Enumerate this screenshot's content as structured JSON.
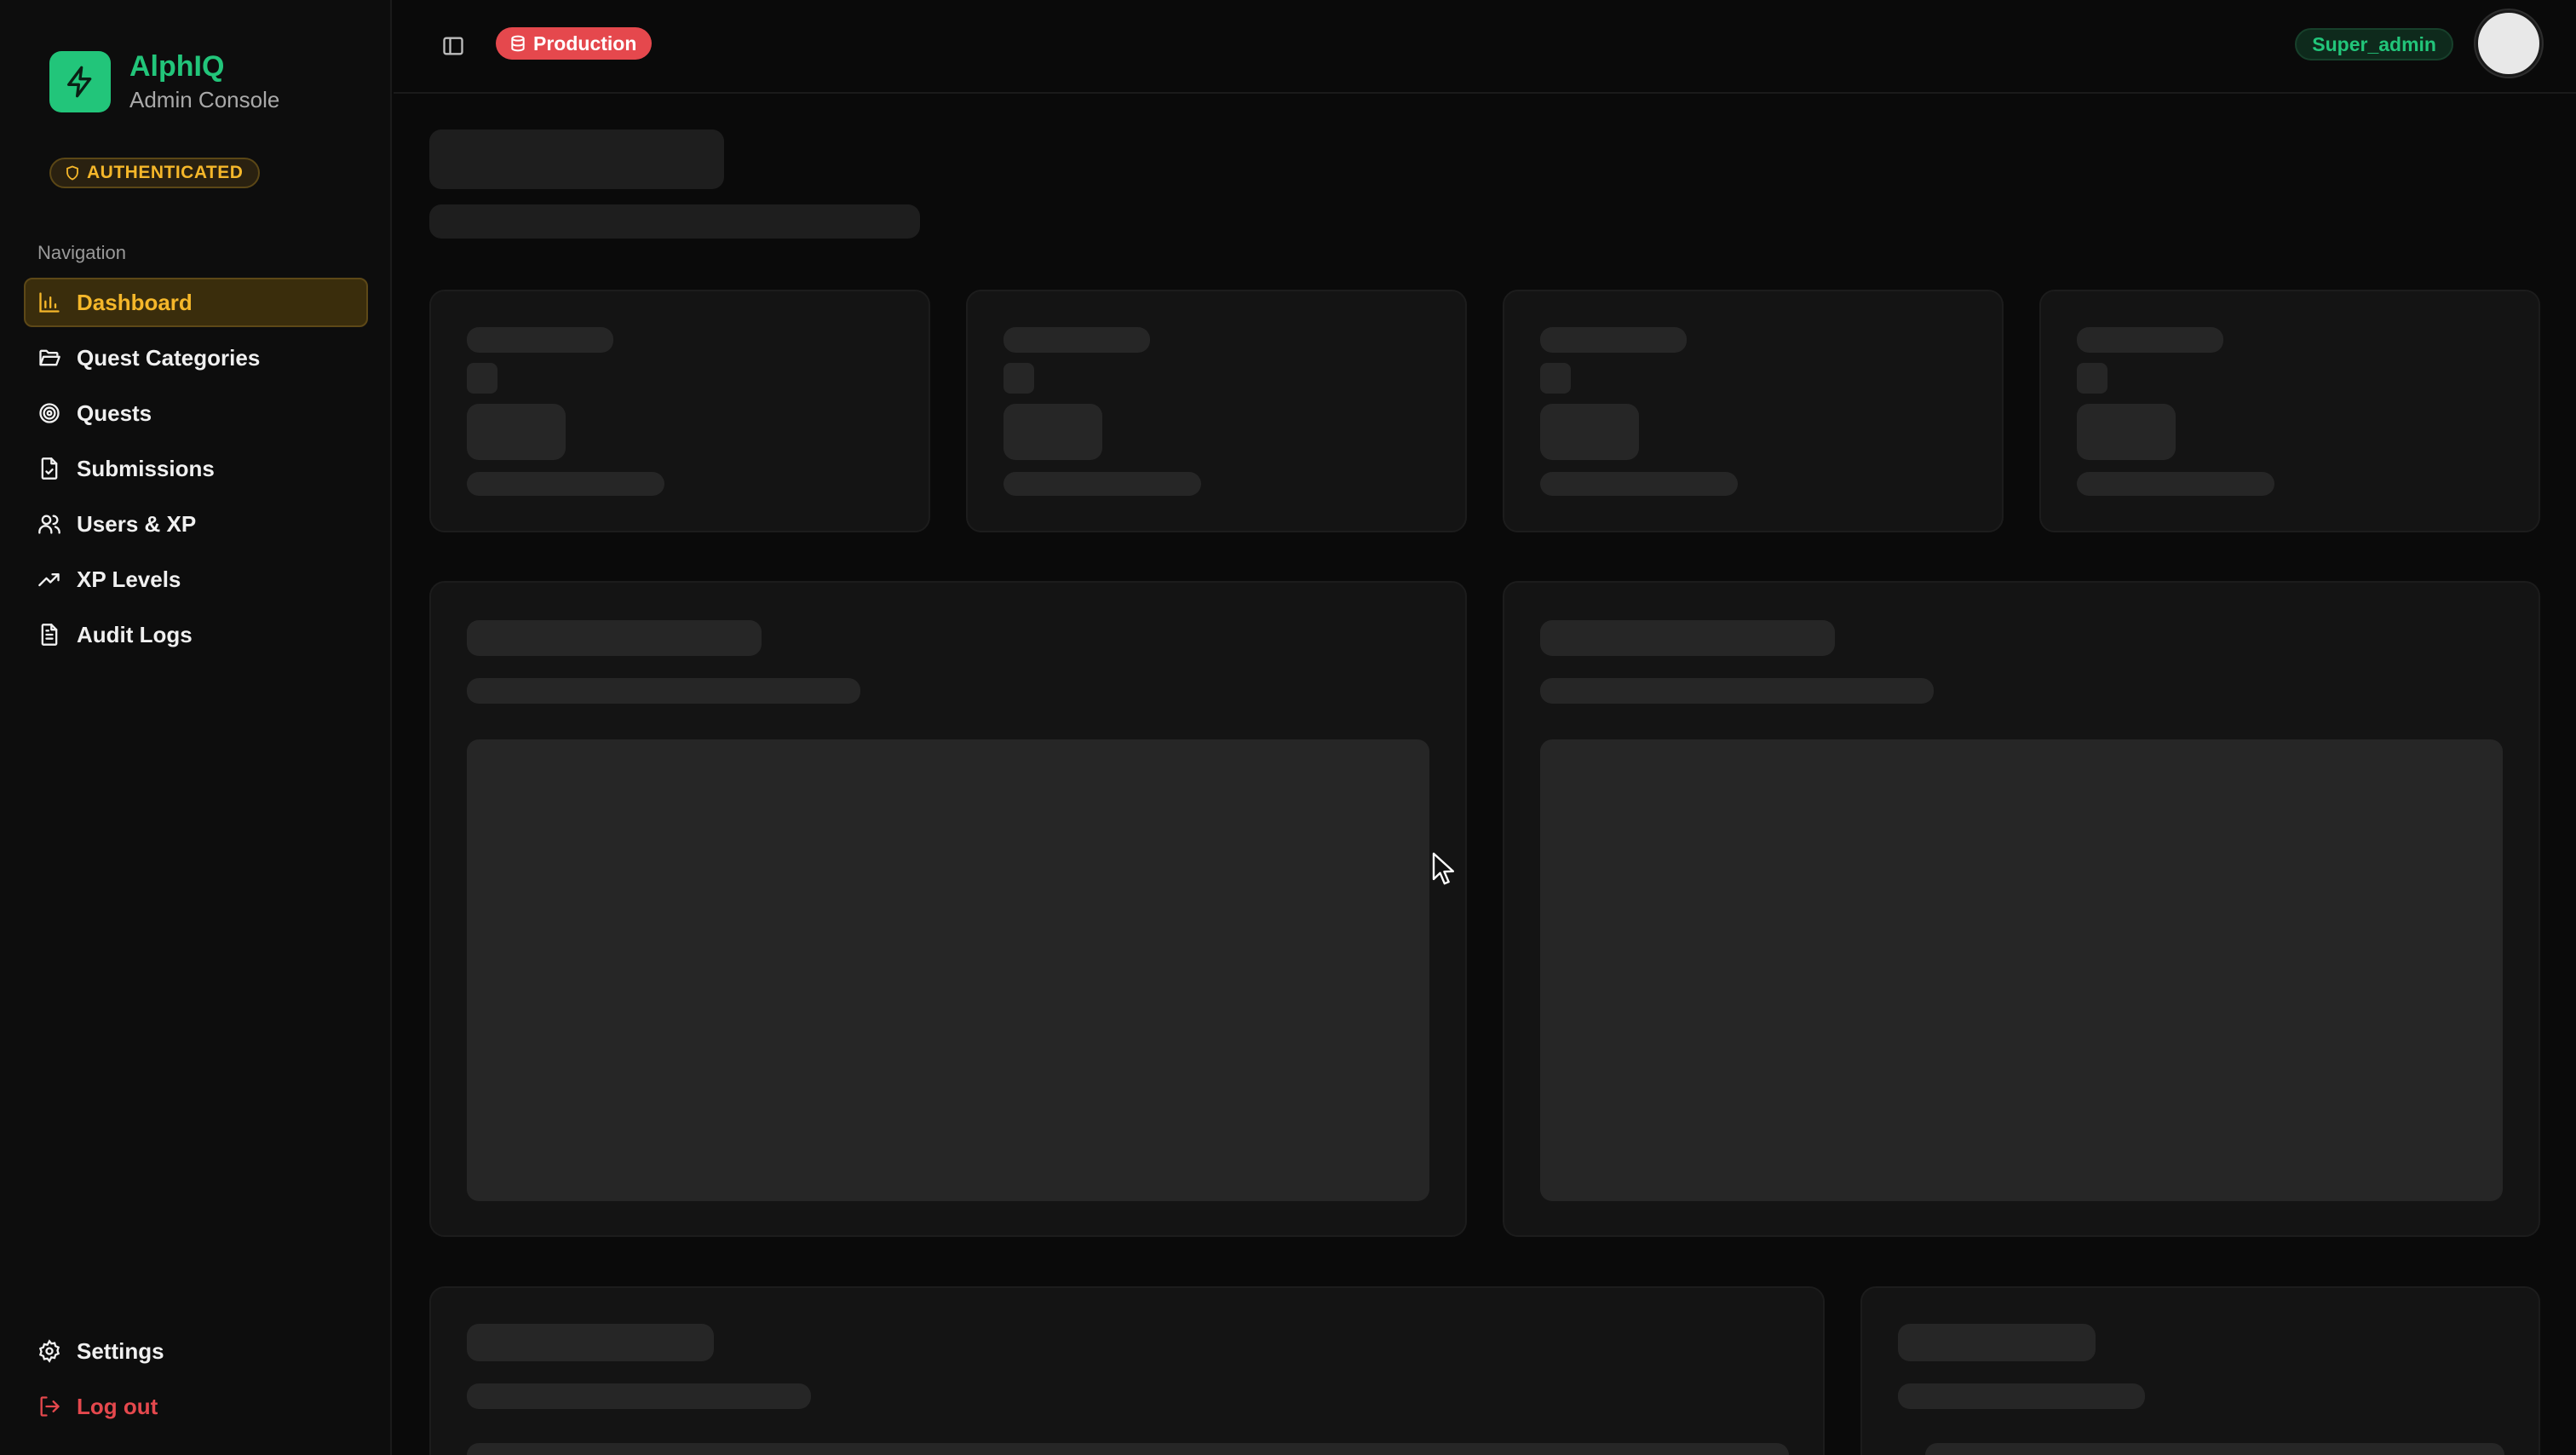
{
  "brand": {
    "name": "AlphIQ",
    "subtitle": "Admin Console",
    "accent": "#22c57a"
  },
  "auth_badge": {
    "label": "AUTHENTICATED",
    "color": "#f5b72a"
  },
  "sidebar": {
    "heading": "Navigation",
    "items": [
      {
        "label": "Dashboard",
        "icon": "bar-chart-icon",
        "active": true
      },
      {
        "label": "Quest Categories",
        "icon": "folder-open-icon",
        "active": false
      },
      {
        "label": "Quests",
        "icon": "target-icon",
        "active": false
      },
      {
        "label": "Submissions",
        "icon": "file-check-icon",
        "active": false
      },
      {
        "label": "Users & XP",
        "icon": "users-icon",
        "active": false
      },
      {
        "label": "XP Levels",
        "icon": "trending-up-icon",
        "active": false
      },
      {
        "label": "Audit Logs",
        "icon": "file-text-icon",
        "active": false
      }
    ],
    "bottom": [
      {
        "label": "Settings",
        "icon": "gear-icon"
      },
      {
        "label": "Log out",
        "icon": "logout-icon"
      }
    ]
  },
  "header": {
    "environment": {
      "label": "Production",
      "icon": "database-icon",
      "color": "#e5484d"
    },
    "role": "Super_admin",
    "toggle_icon": "sidebar-toggle-icon"
  },
  "state": {
    "loading": true
  }
}
